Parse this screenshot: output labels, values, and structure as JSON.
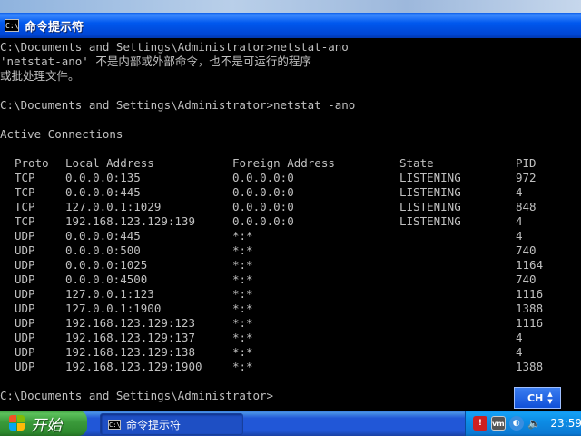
{
  "window": {
    "title": "命令提示符",
    "icon_text": "C:\\"
  },
  "console": {
    "lines": [
      "C:\\Documents and Settings\\Administrator>netstat-ano",
      "'netstat-ano' 不是内部或外部命令，也不是可运行的程序",
      "或批处理文件。",
      "",
      "C:\\Documents and Settings\\Administrator>netstat -ano",
      "",
      "Active Connections",
      ""
    ],
    "prompt": "C:\\Documents and Settings\\Administrator>",
    "table": {
      "headers": [
        "Proto",
        "Local Address",
        "Foreign Address",
        "State",
        "PID"
      ],
      "rows": [
        [
          "TCP",
          "0.0.0.0:135",
          "0.0.0.0:0",
          "LISTENING",
          "972"
        ],
        [
          "TCP",
          "0.0.0.0:445",
          "0.0.0.0:0",
          "LISTENING",
          "4"
        ],
        [
          "TCP",
          "127.0.0.1:1029",
          "0.0.0.0:0",
          "LISTENING",
          "848"
        ],
        [
          "TCP",
          "192.168.123.129:139",
          "0.0.0.0:0",
          "LISTENING",
          "4"
        ],
        [
          "UDP",
          "0.0.0.0:445",
          "*:*",
          "",
          "4"
        ],
        [
          "UDP",
          "0.0.0.0:500",
          "*:*",
          "",
          "740"
        ],
        [
          "UDP",
          "0.0.0.0:1025",
          "*:*",
          "",
          "1164"
        ],
        [
          "UDP",
          "0.0.0.0:4500",
          "*:*",
          "",
          "740"
        ],
        [
          "UDP",
          "127.0.0.1:123",
          "*:*",
          "",
          "1116"
        ],
        [
          "UDP",
          "127.0.0.1:1900",
          "*:*",
          "",
          "1388"
        ],
        [
          "UDP",
          "192.168.123.129:123",
          "*:*",
          "",
          "1116"
        ],
        [
          "UDP",
          "192.168.123.129:137",
          "*:*",
          "",
          "4"
        ],
        [
          "UDP",
          "192.168.123.129:138",
          "*:*",
          "",
          "4"
        ],
        [
          "UDP",
          "192.168.123.129:1900",
          "*:*",
          "",
          "1388"
        ]
      ]
    }
  },
  "ime": {
    "label": "CH"
  },
  "taskbar": {
    "start_label": "开始",
    "task_label": "命令提示符",
    "task_icon_text": "C:\\",
    "tray_icons": [
      "shield-icon",
      "vmware-icon",
      "network-icon",
      "sound-icon"
    ],
    "tray_vm_text": "vm",
    "clock": "23:59"
  },
  "colors": {
    "console_text": "#c0c0c0",
    "console_bg": "#000000",
    "titlebar": "#0058ee",
    "taskbar": "#2157d7",
    "start_button": "#3a9a3a"
  }
}
